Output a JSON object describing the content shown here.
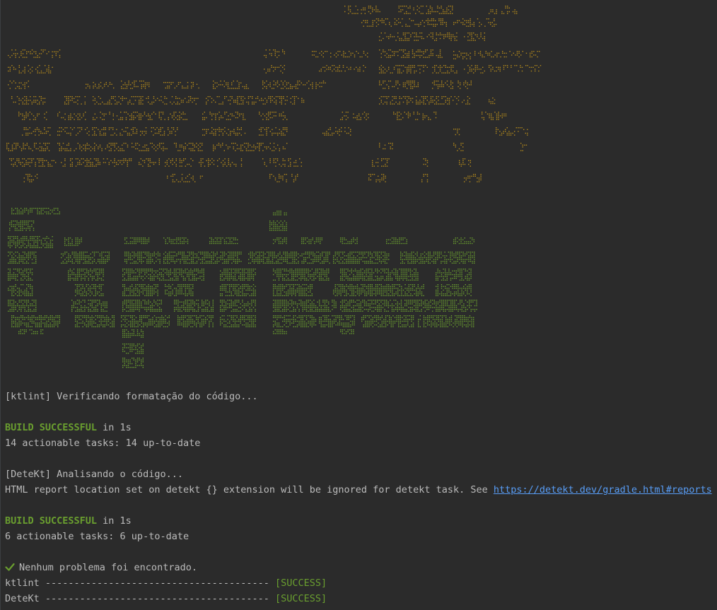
{
  "colors": {
    "background": "#2b2b2b",
    "text": "#bbbbbb",
    "success": "#6a9f2f",
    "art_sun": "#b58b1c",
    "art_logo": "#6a9f2f",
    "link": "#589df6"
  },
  "banner": {
    "description_icon": "sun-icon",
    "logo_word": "Experience"
  },
  "output": {
    "ktlint_start": "[ktlint] Verificando formatação do código...",
    "build1_status": "BUILD SUCCESSFUL",
    "build1_time": " in 1s",
    "build1_tasks": "14 actionable tasks: 14 up-to-date",
    "detekt_start": "[DeteKt] Analisando o código...",
    "detekt_warning_prefix": "HTML report location set on detekt {} extension will be ignored for detekt task. See ",
    "detekt_link": "https://detekt.dev/gradle.html#reports",
    "build2_status": "BUILD SUCCESSFUL",
    "build2_time": " in 1s",
    "build2_tasks": "6 actionable tasks: 6 up-to-date",
    "no_problems": "Nenhum problema foi encontrado.",
    "summary": [
      {
        "tool": "ktlint ",
        "dashes": "--------------------------------------- ",
        "result": "[SUCCESS]"
      },
      {
        "tool": "DeteKt ",
        "dashes": "--------------------------------------- ",
        "result": "[SUCCESS]"
      }
    ]
  }
}
